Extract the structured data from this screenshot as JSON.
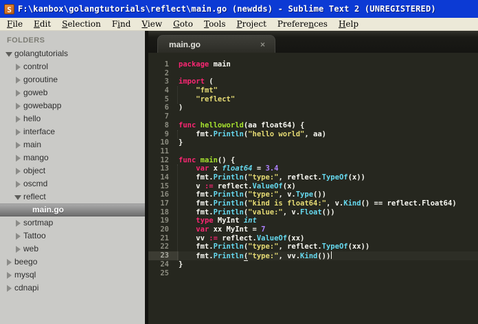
{
  "window": {
    "title": "F:\\kanbox\\golangtutorials\\reflect\\main.go (newdds) - Sublime Text 2 (UNREGISTERED)",
    "icon": "sublime-logo",
    "icon_letter": "S"
  },
  "menu": {
    "items": [
      {
        "label": "File",
        "underline": 0
      },
      {
        "label": "Edit",
        "underline": 0
      },
      {
        "label": "Selection",
        "underline": 0
      },
      {
        "label": "Find",
        "underline": 1
      },
      {
        "label": "View",
        "underline": 0
      },
      {
        "label": "Goto",
        "underline": 0
      },
      {
        "label": "Tools",
        "underline": 0
      },
      {
        "label": "Project",
        "underline": 0
      },
      {
        "label": "Preferences",
        "underline": 7
      },
      {
        "label": "Help",
        "underline": 0
      }
    ]
  },
  "sidebar": {
    "header": "FOLDERS",
    "items": [
      {
        "label": "golangtutorials",
        "level": 0,
        "arrow": "expanded",
        "selected": false
      },
      {
        "label": "control",
        "level": 1,
        "arrow": "collapsed",
        "selected": false
      },
      {
        "label": "goroutine",
        "level": 1,
        "arrow": "collapsed",
        "selected": false
      },
      {
        "label": "goweb",
        "level": 1,
        "arrow": "collapsed",
        "selected": false
      },
      {
        "label": "gowebapp",
        "level": 1,
        "arrow": "collapsed",
        "selected": false
      },
      {
        "label": "hello",
        "level": 1,
        "arrow": "collapsed",
        "selected": false
      },
      {
        "label": "interface",
        "level": 1,
        "arrow": "collapsed",
        "selected": false
      },
      {
        "label": "main",
        "level": 1,
        "arrow": "collapsed",
        "selected": false
      },
      {
        "label": "mango",
        "level": 1,
        "arrow": "collapsed",
        "selected": false
      },
      {
        "label": "object",
        "level": 1,
        "arrow": "collapsed",
        "selected": false
      },
      {
        "label": "oscmd",
        "level": 1,
        "arrow": "collapsed",
        "selected": false
      },
      {
        "label": "reflect",
        "level": 1,
        "arrow": "expanded",
        "selected": false
      },
      {
        "label": "main.go",
        "level": 2,
        "arrow": "none",
        "selected": true
      },
      {
        "label": "sortmap",
        "level": 1,
        "arrow": "collapsed",
        "selected": false
      },
      {
        "label": "Tattoo",
        "level": 1,
        "arrow": "collapsed",
        "selected": false
      },
      {
        "label": "web",
        "level": 1,
        "arrow": "collapsed",
        "selected": false
      },
      {
        "label": "beego",
        "level": 0,
        "arrow": "collapsed",
        "selected": false
      },
      {
        "label": "mysql",
        "level": 0,
        "arrow": "collapsed",
        "selected": false
      },
      {
        "label": "cdnapi",
        "level": 0,
        "arrow": "collapsed",
        "selected": false
      }
    ]
  },
  "tabs": [
    {
      "label": "main.go",
      "close_glyph": "×",
      "active": true
    }
  ],
  "editor": {
    "language": "go",
    "current_line": 23,
    "indent_guides": [
      {
        "from": 4,
        "to": 5
      },
      {
        "from": 9,
        "to": 9
      },
      {
        "from": 13,
        "to": 23
      }
    ],
    "lines": [
      {
        "n": 1,
        "segs": [
          [
            "kw",
            "package"
          ],
          [
            "pln",
            " main"
          ]
        ]
      },
      {
        "n": 2,
        "segs": []
      },
      {
        "n": 3,
        "segs": [
          [
            "kw",
            "import"
          ],
          [
            "pln",
            " ("
          ]
        ]
      },
      {
        "n": 4,
        "segs": [
          [
            "pln",
            "    "
          ],
          [
            "str",
            "\"fmt\""
          ]
        ]
      },
      {
        "n": 5,
        "segs": [
          [
            "pln",
            "    "
          ],
          [
            "str",
            "\"reflect\""
          ]
        ]
      },
      {
        "n": 6,
        "segs": [
          [
            "pln",
            ")"
          ]
        ]
      },
      {
        "n": 7,
        "segs": []
      },
      {
        "n": 8,
        "segs": [
          [
            "kw",
            "func"
          ],
          [
            "pln",
            " "
          ],
          [
            "fn",
            "helloworld"
          ],
          [
            "pln",
            "(aa float64) {"
          ]
        ]
      },
      {
        "n": 9,
        "segs": [
          [
            "pln",
            "    fmt."
          ],
          [
            "call",
            "Println"
          ],
          [
            "pln",
            "("
          ],
          [
            "str",
            "\"hello world\""
          ],
          [
            "pln",
            ", aa)"
          ]
        ]
      },
      {
        "n": 10,
        "segs": [
          [
            "pln",
            "}"
          ]
        ]
      },
      {
        "n": 11,
        "segs": []
      },
      {
        "n": 12,
        "segs": [
          [
            "kw",
            "func"
          ],
          [
            "pln",
            " "
          ],
          [
            "fn",
            "main"
          ],
          [
            "pln",
            "() {"
          ]
        ]
      },
      {
        "n": 13,
        "segs": [
          [
            "pln",
            "    "
          ],
          [
            "kw",
            "var"
          ],
          [
            "pln",
            " x "
          ],
          [
            "typ",
            "float64"
          ],
          [
            "pln",
            " = "
          ],
          [
            "num",
            "3.4"
          ]
        ]
      },
      {
        "n": 14,
        "segs": [
          [
            "pln",
            "    fmt."
          ],
          [
            "call",
            "Println"
          ],
          [
            "pln",
            "("
          ],
          [
            "str",
            "\"type:\""
          ],
          [
            "pln",
            ", reflect."
          ],
          [
            "call",
            "TypeOf"
          ],
          [
            "pln",
            "(x))"
          ]
        ]
      },
      {
        "n": 15,
        "segs": [
          [
            "pln",
            "    v "
          ],
          [
            "kw",
            ":="
          ],
          [
            "pln",
            " reflect."
          ],
          [
            "call",
            "ValueOf"
          ],
          [
            "pln",
            "(x)"
          ]
        ]
      },
      {
        "n": 16,
        "segs": [
          [
            "pln",
            "    fmt."
          ],
          [
            "call",
            "Println"
          ],
          [
            "pln",
            "("
          ],
          [
            "str",
            "\"type:\""
          ],
          [
            "pln",
            ", v."
          ],
          [
            "call",
            "Type"
          ],
          [
            "pln",
            "())"
          ]
        ]
      },
      {
        "n": 17,
        "segs": [
          [
            "pln",
            "    fmt."
          ],
          [
            "call",
            "Println"
          ],
          [
            "pln",
            "("
          ],
          [
            "str",
            "\"kind is float64:\""
          ],
          [
            "pln",
            ", v."
          ],
          [
            "call",
            "Kind"
          ],
          [
            "pln",
            "() == reflect.Float64)"
          ]
        ]
      },
      {
        "n": 18,
        "segs": [
          [
            "pln",
            "    fmt."
          ],
          [
            "call",
            "Println"
          ],
          [
            "pln",
            "("
          ],
          [
            "str",
            "\"value:\""
          ],
          [
            "pln",
            ", v."
          ],
          [
            "call",
            "Float"
          ],
          [
            "pln",
            "())"
          ]
        ]
      },
      {
        "n": 19,
        "segs": [
          [
            "pln",
            "    "
          ],
          [
            "kw",
            "type"
          ],
          [
            "pln",
            " MyInt "
          ],
          [
            "typ",
            "int"
          ]
        ]
      },
      {
        "n": 20,
        "segs": [
          [
            "pln",
            "    "
          ],
          [
            "kw",
            "var"
          ],
          [
            "pln",
            " xx MyInt = "
          ],
          [
            "num",
            "7"
          ]
        ]
      },
      {
        "n": 21,
        "segs": [
          [
            "pln",
            "    vv "
          ],
          [
            "kw",
            ":="
          ],
          [
            "pln",
            " reflect."
          ],
          [
            "call",
            "ValueOf"
          ],
          [
            "pln",
            "(xx)"
          ]
        ]
      },
      {
        "n": 22,
        "segs": [
          [
            "pln",
            "    fmt."
          ],
          [
            "call",
            "Println"
          ],
          [
            "pln",
            "("
          ],
          [
            "str",
            "\"type:\""
          ],
          [
            "pln",
            ", reflect."
          ],
          [
            "call",
            "TypeOf"
          ],
          [
            "pln",
            "(xx))"
          ]
        ]
      },
      {
        "n": 23,
        "segs": [
          [
            "pln",
            "    fmt."
          ],
          [
            "call",
            "Println"
          ],
          [
            "ul",
            "("
          ],
          [
            "str",
            "\"type:\""
          ],
          [
            "pln",
            ", vv."
          ],
          [
            "call",
            "Kind"
          ],
          [
            "pln",
            "())"
          ],
          [
            "caret",
            ""
          ]
        ]
      },
      {
        "n": 24,
        "segs": [
          [
            "pln",
            "}"
          ]
        ]
      },
      {
        "n": 25,
        "segs": []
      }
    ]
  },
  "colors": {
    "titlebar_blue": "#0c3ad4",
    "menubar_bg": "#ece9d8",
    "sidebar_bg": "#cacac7",
    "sidebar_selected_top": "#aaaaaa",
    "sidebar_selected_bottom": "#6e6e6e",
    "editor_bg": "#26271f",
    "keyword_pink": "#f92672",
    "function_green": "#a6e22e",
    "type_blue": "#66d9ef",
    "string_yellow": "#e6db74",
    "number_purple": "#ae81ff",
    "text_white": "#f8f8f2",
    "line_number_gray": "#8c8c80"
  }
}
